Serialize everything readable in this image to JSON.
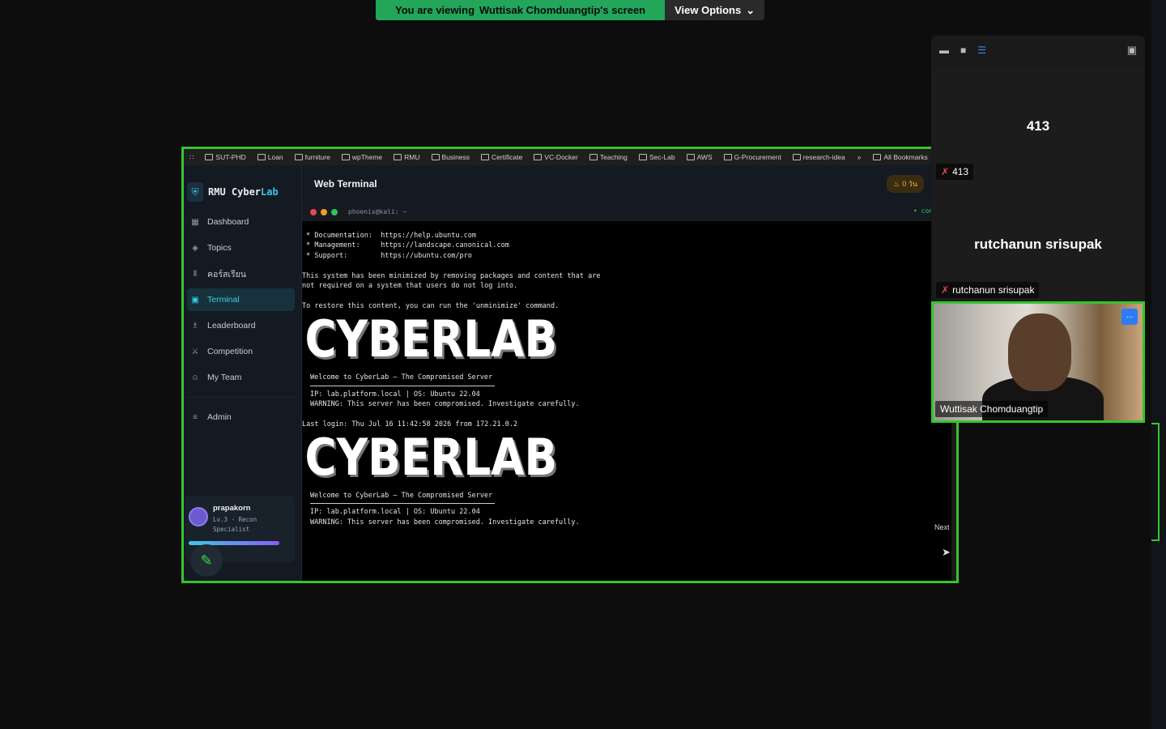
{
  "banner": {
    "prefix": "You are viewing",
    "owner": "Wuttisak Chomduangtip's screen",
    "view_options": "View Options"
  },
  "bookmarks": [
    "SUT-PHD",
    "Loan",
    "furniture",
    "wpTheme",
    "RMU",
    "Business",
    "Certificate",
    "VC-Docker",
    "Teaching",
    "Sec-Lab",
    "AWS",
    "G-Procurement",
    "research-idea"
  ],
  "bookmarks_overflow": "»",
  "all_bookmarks": "All Bookmarks",
  "app": {
    "logo_prefix": "RMU Cyber",
    "logo_accent": "Lab",
    "nav": [
      {
        "label": "Dashboard",
        "icon": "dashboard-icon"
      },
      {
        "label": "Topics",
        "icon": "topics-icon"
      },
      {
        "label": "คอร์สเรียน",
        "icon": "courses-icon"
      },
      {
        "label": "Terminal",
        "icon": "terminal-icon",
        "active": true
      },
      {
        "label": "Leaderboard",
        "icon": "trophy-icon"
      },
      {
        "label": "Competition",
        "icon": "swords-icon"
      },
      {
        "label": "My Team",
        "icon": "team-icon"
      }
    ],
    "admin": "Admin",
    "profile": {
      "name": "prapakorn",
      "level": "Lv.3 · Recon Specialist"
    },
    "header_title": "Web Terminal",
    "coins": "0 วัน",
    "terminal": {
      "title": "phoenix@kali: ~",
      "status": "• connected",
      "lines_top": [
        " * Documentation:  https://help.ubuntu.com",
        " * Management:     https://landscape.canonical.com",
        " * Support:        https://ubuntu.com/pro"
      ],
      "minimized_1": "This system has been minimized by removing packages and content that are",
      "minimized_2": "not required on a system that users do not log into.",
      "restore": "To restore this content, you can run the 'unminimize' command.",
      "banner_art": "CYBERLAB",
      "welcome": "Welcome to CyberLab — The Compromised Server",
      "ip_line": "IP: lab.platform.local | OS: Ubuntu 22.04",
      "warning": "WARNING: This server has been compromised. Investigate carefully.",
      "last_login": "Last login: Thu Jul 16 11:42:58 2026 from 172.21.0.2"
    }
  },
  "panel": {
    "tile1_big": "413",
    "tile1_label": "413",
    "tile2_big": "rutchanun srisupak",
    "tile2_label": "rutchanun srisupak",
    "video_name": "Wuttisak Chomduangtip",
    "more": "..."
  },
  "next_label": "Next"
}
